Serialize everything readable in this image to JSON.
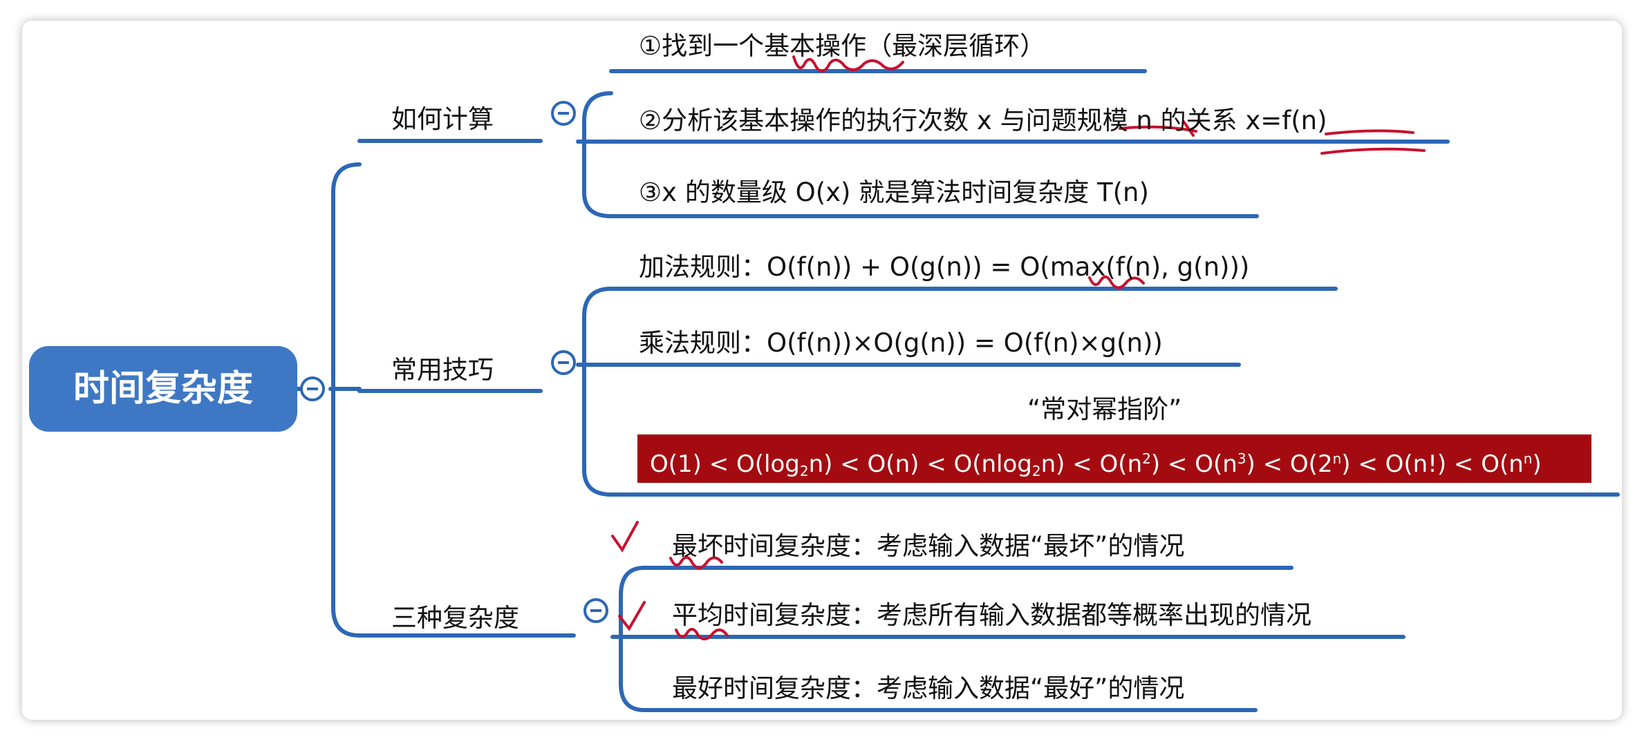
{
  "root": {
    "label": "时间复杂度"
  },
  "how_to_compute": {
    "label": "如何计算",
    "steps": [
      {
        "num": "①",
        "text": "找到一个基本操作（最深层循环）"
      },
      {
        "num": "②",
        "text": "分析该基本操作的执行次数 x 与问题规模 n 的关系 x=f(n)"
      },
      {
        "num": "③",
        "text": "x 的数量级 O(x) 就是算法时间复杂度 T(n)"
      }
    ]
  },
  "techniques": {
    "label": "常用技巧",
    "add_rule": "加法规则：O(f(n)) + O(g(n)) = O(max(f(n), g(n)))",
    "mul_rule": "乘法规则：O(f(n))×O(g(n)) = O(f(n)×g(n))",
    "mnemonic": "“常对幂指阶”",
    "order": {
      "t1": "O(1) < O(log",
      "s1": "2",
      "t2": "n) < O(n) < O(nlog",
      "s2": "2",
      "t3": "n) < O(n",
      "p1": "2",
      "t4": ") < O(n",
      "p2": "3",
      "t5": ") < O(2",
      "p3": "n",
      "t6": ") < O(n!) < O(n",
      "p4": "n",
      "t7": ")"
    }
  },
  "three_kinds": {
    "label": "三种复杂度",
    "worst": "最坏时间复杂度：考虑输入数据“最坏”的情况",
    "average": "平均时间复杂度：考虑所有输入数据都等概率出现的情况",
    "best": "最好时间复杂度：考虑输入数据“最好”的情况"
  },
  "colors": {
    "line": "#2d67b5",
    "root_fill": "#3e78c4",
    "order_fill": "#a40b10",
    "annotation": "#c8102e"
  }
}
